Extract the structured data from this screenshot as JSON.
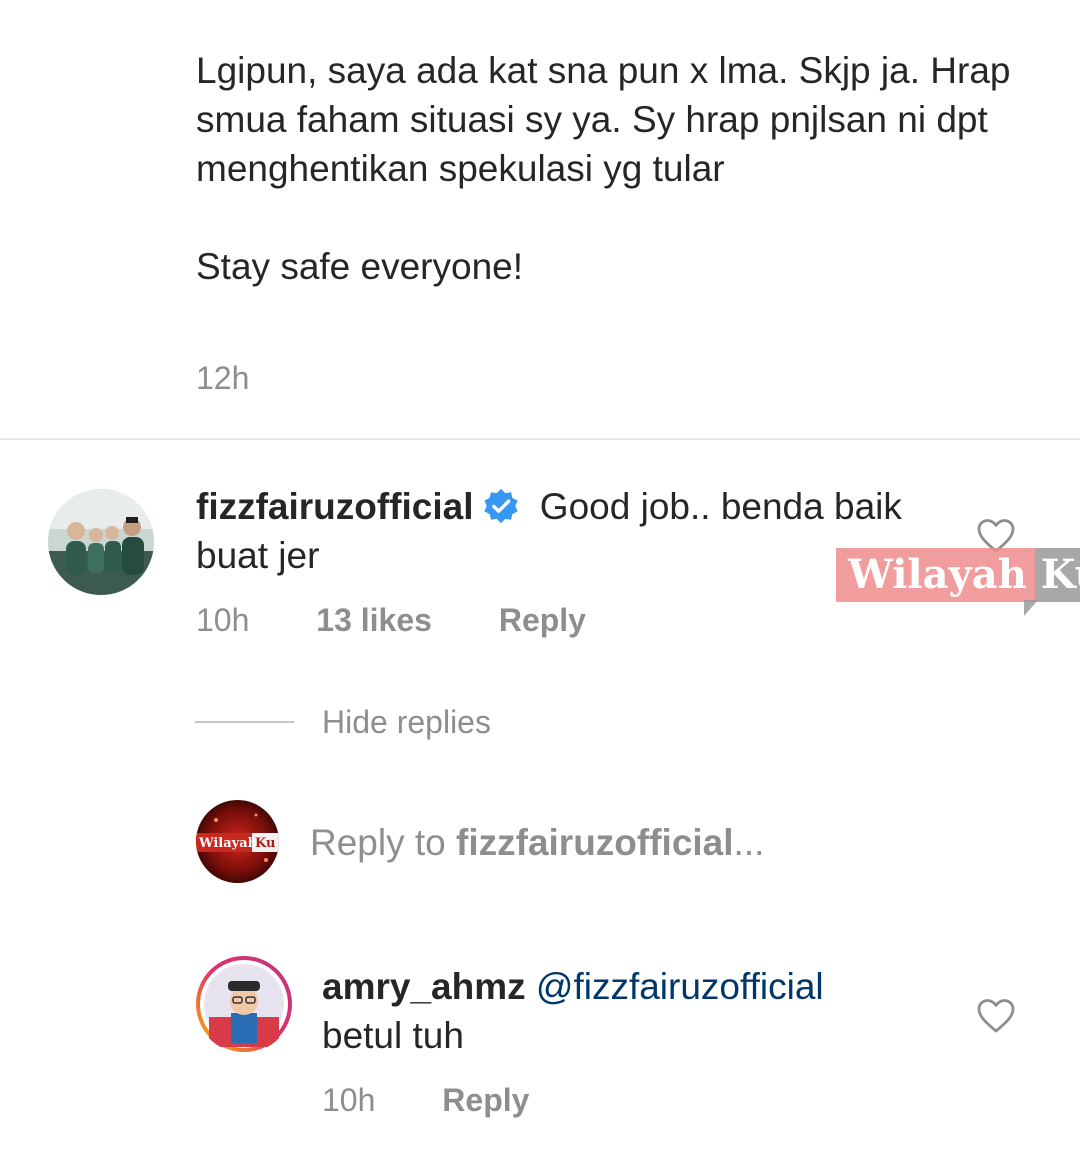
{
  "caption": {
    "text": "Lgipun, saya ada kat sna pun x lma. Skjp ja. Hrap smua faham situasi sy ya. Sy hrap pnjlsan ni dpt menghentikan spekulasi yg tular\n\nStay safe everyone!",
    "time": "12h"
  },
  "comment1": {
    "username": "fizzfairuzofficial",
    "text": " Good job.. benda baik buat jer",
    "time": "10h",
    "likes": "13 likes",
    "reply_label": "Reply",
    "verified_icon": "verified-badge-icon",
    "like_icon": "heart-icon"
  },
  "hide_replies": "Hide replies",
  "reply_box": {
    "prefix": "Reply to ",
    "target": "fizzfairuzofficial",
    "suffix": "...",
    "avatar_text_left": "Wilayah",
    "avatar_text_right": "Ku"
  },
  "comment2": {
    "username": "amry_ahmz",
    "mention": "@fizzfairuzofficial",
    "text": "betul tuh",
    "time": "10h",
    "reply_label": "Reply",
    "like_icon": "heart-icon"
  },
  "watermark": {
    "left": "Wilayah",
    "right": "Ku"
  },
  "colors": {
    "text": "#262626",
    "meta": "#8e8e8e",
    "mention": "#00376b",
    "verified": "#3897f0",
    "divider": "#e6e6e6"
  }
}
